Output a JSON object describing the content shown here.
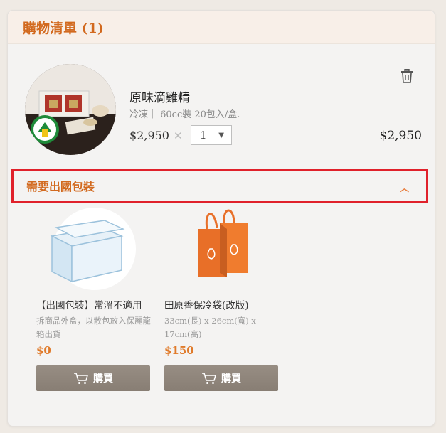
{
  "cart": {
    "title": "購物清單 (1)",
    "item": {
      "name": "原味滴雞精",
      "spec": "冷凍｜ 60cc裝 20包入/盒.",
      "price": "$2,950",
      "times": "✕",
      "quantity": "1",
      "total": "$2,950"
    }
  },
  "section": {
    "title": "需要出國包裝",
    "chevron": "︿"
  },
  "products": [
    {
      "name": "【出國包裝】常溫不適用",
      "desc": "拆商品外盒，以散包放入保麗龍箱出貨",
      "price": "$0",
      "buy_label": "購買"
    },
    {
      "name": "田原香保冷袋(改版)",
      "desc": "33cm(長) x 26cm(寬) x 17cm(高)",
      "price": "$150",
      "buy_label": "購買"
    }
  ],
  "icons": {
    "trash": "trash-icon",
    "cart": "cart-icon"
  },
  "colors": {
    "accent": "#d2691e",
    "highlight_border": "#e0212b",
    "buy_button": "#8f857a",
    "price": "#e07a2a"
  }
}
